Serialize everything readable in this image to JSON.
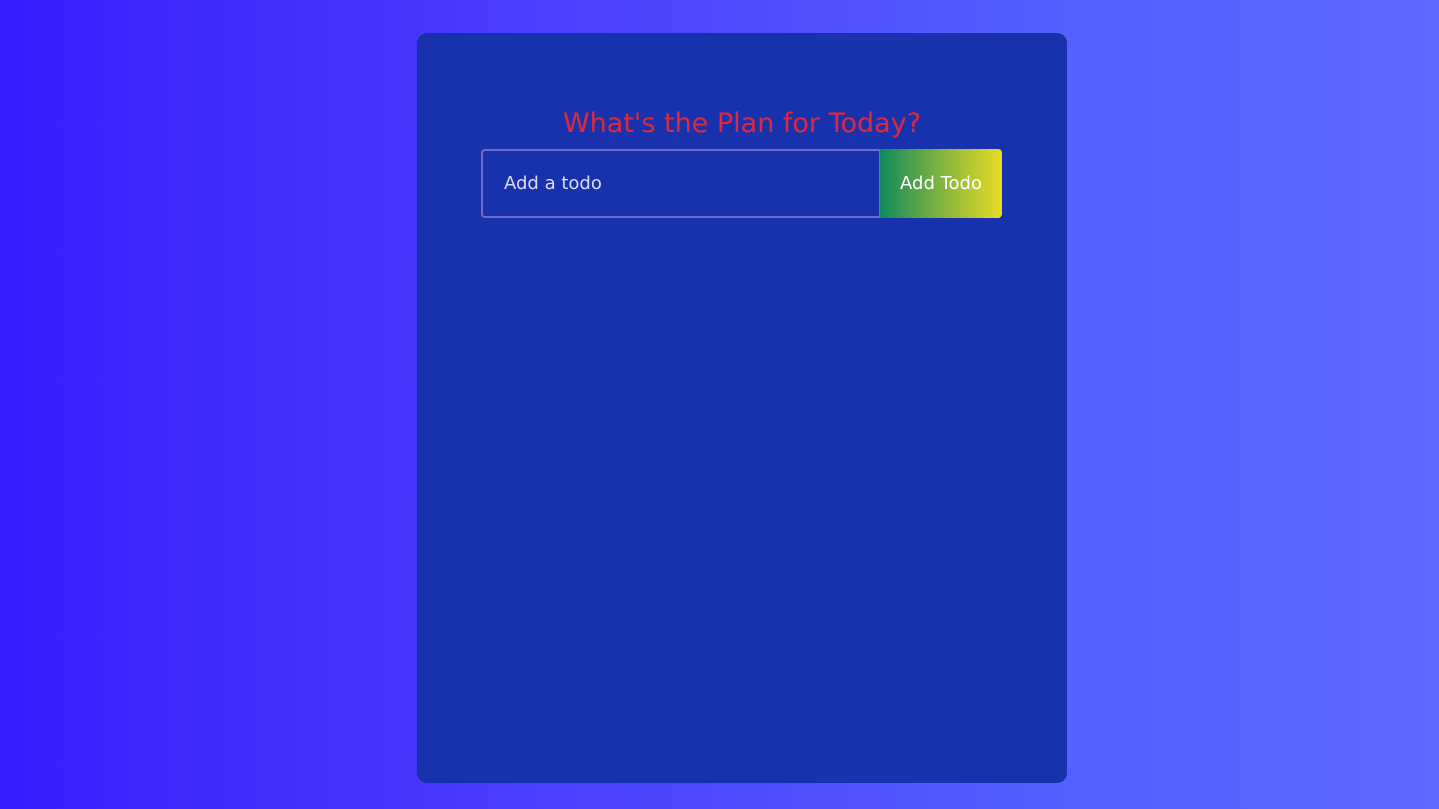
{
  "app": {
    "title": "What's the Plan for Today?"
  },
  "form": {
    "input_placeholder": "Add a todo",
    "input_value": "",
    "add_button_label": "Add Todo"
  },
  "todos": [],
  "colors": {
    "page_gradient_start": "#371dfd",
    "page_gradient_end": "#6066fe",
    "card_background": "#1832ad",
    "title_color": "#e0283a",
    "input_border": "#7469c7",
    "button_gradient_start": "#0f8a5a",
    "button_gradient_end": "#e8dc23"
  }
}
